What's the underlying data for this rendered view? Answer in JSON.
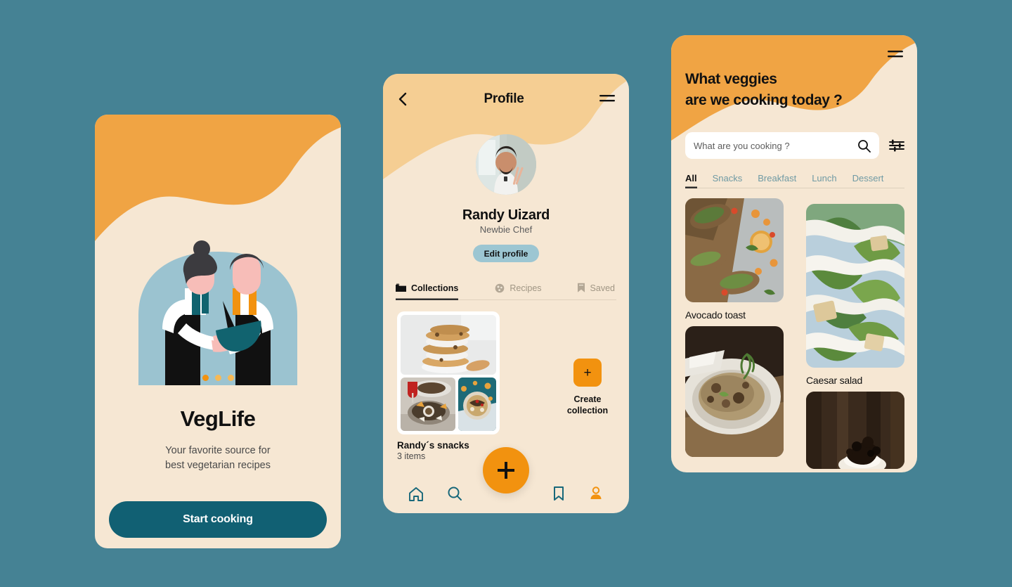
{
  "theme": {
    "background_teal": "#458294",
    "cream": "#F6E7D3",
    "orange": "#F0A444",
    "orange_strong": "#F2920F",
    "light_orange": "#F5CE93",
    "teal_dark": "#116073",
    "light_blue": "#9CC6D2"
  },
  "onboarding": {
    "title": "VegLife",
    "subtitle_line1": "Your favorite source for",
    "subtitle_line2": "best vegetarian recipes",
    "cta_label": "Start cooking",
    "dots_total": 3,
    "dot_active_index": 0,
    "illustration": "two-chefs-illustration"
  },
  "profile": {
    "header_title": "Profile",
    "back_icon": "chevron-left-icon",
    "menu_icon": "hamburger-menu-icon",
    "avatar": "user-avatar-photo",
    "name": "Randy Uizard",
    "role": "Newbie Chef",
    "edit_label": "Edit profile",
    "tabs": [
      {
        "label": "Collections",
        "icon": "folder-icon",
        "active": true
      },
      {
        "label": "Recipes",
        "icon": "cookie-icon",
        "active": false
      },
      {
        "label": "Saved",
        "icon": "bookmark-icon",
        "active": false
      }
    ],
    "collection": {
      "name": "Randy´s snacks",
      "count": "3 items"
    },
    "create_collection": {
      "plus": "+",
      "label_line1": "Create",
      "label_line2": "collection"
    },
    "nav": [
      {
        "icon": "home-icon",
        "active": false
      },
      {
        "icon": "search-icon",
        "active": false
      },
      {
        "icon": "plus-fab-icon",
        "active": false
      },
      {
        "icon": "bookmark-icon",
        "active": false
      },
      {
        "icon": "person-icon",
        "active": true
      }
    ]
  },
  "discover": {
    "menu_icon": "hamburger-menu-icon",
    "heading_line1": "What veggies",
    "heading_line2": "are we cooking today ?",
    "search": {
      "placeholder": "What are you cooking ?",
      "value": "",
      "search_icon": "search-icon",
      "filter_icon": "filter-sliders-icon"
    },
    "categories": [
      {
        "label": "All",
        "active": true
      },
      {
        "label": "Snacks",
        "active": false
      },
      {
        "label": "Breakfast",
        "active": false
      },
      {
        "label": "Lunch",
        "active": false
      },
      {
        "label": "Dessert",
        "active": false
      }
    ],
    "recipes_left": [
      {
        "title": "Avocado toast",
        "image": "avocado-toast-photo"
      },
      {
        "title": "",
        "image": "mushroom-risotto-photo"
      }
    ],
    "recipes_right": [
      {
        "title": "Caesar salad",
        "image": "caesar-salad-photo"
      },
      {
        "title": "",
        "image": "chocolate-dessert-photo"
      }
    ]
  }
}
